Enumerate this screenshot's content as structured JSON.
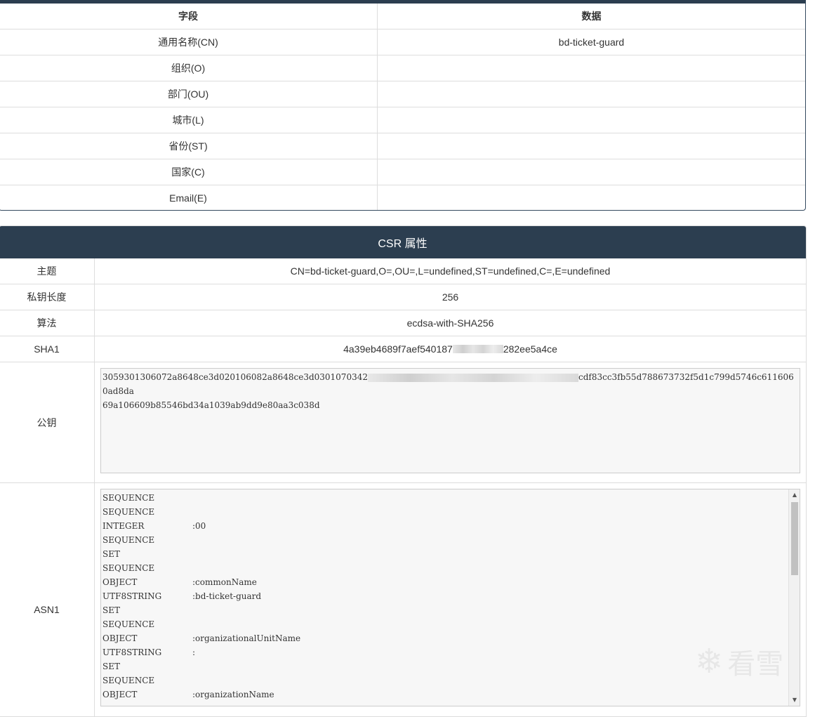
{
  "subject_table": {
    "headers": {
      "field": "字段",
      "data": "数据"
    },
    "rows": [
      {
        "field": "通用名称(CN)",
        "data": "bd-ticket-guard"
      },
      {
        "field": "组织(O)",
        "data": ""
      },
      {
        "field": "部门(OU)",
        "data": ""
      },
      {
        "field": "城市(L)",
        "data": ""
      },
      {
        "field": "省份(ST)",
        "data": ""
      },
      {
        "field": "国家(C)",
        "data": ""
      },
      {
        "field": "Email(E)",
        "data": ""
      }
    ]
  },
  "csr": {
    "title": "CSR 属性",
    "subject_label": "主题",
    "subject_value": "CN=bd-ticket-guard,O=,OU=,L=undefined,ST=undefined,C=,E=undefined",
    "keylen_label": "私钥长度",
    "keylen_value": "256",
    "algo_label": "算法",
    "algo_value": "ecdsa-with-SHA256",
    "sha1_label": "SHA1",
    "sha1_prefix": "4a39eb4689f7aef540187",
    "sha1_suffix": "282ee5a4ce",
    "pubkey_label": "公钥",
    "pubkey_prefix": "3059301306072a8648ce3d020106082a8648ce3d0301070342",
    "pubkey_suffix": "cdf83cc3fb55d788673732f5d1c799d5746c6116060ad8da",
    "pubkey_line2": "69a106609b85546bd34a1039ab9dd9e80aa3c038d",
    "asn1_label": "ASN1",
    "asn1_lines": [
      {
        "type": "SEQUENCE",
        "value": ""
      },
      {
        "type": "SEQUENCE",
        "value": ""
      },
      {
        "type": "INTEGER",
        "value": ":00"
      },
      {
        "type": "SEQUENCE",
        "value": ""
      },
      {
        "type": "SET",
        "value": ""
      },
      {
        "type": "SEQUENCE",
        "value": ""
      },
      {
        "type": "OBJECT",
        "value": ":commonName"
      },
      {
        "type": "UTF8STRING",
        "value": ":bd-ticket-guard"
      },
      {
        "type": "SET",
        "value": ""
      },
      {
        "type": "SEQUENCE",
        "value": ""
      },
      {
        "type": "OBJECT",
        "value": ":organizationalUnitName"
      },
      {
        "type": "UTF8STRING",
        "value": ":"
      },
      {
        "type": "SET",
        "value": ""
      },
      {
        "type": "SEQUENCE",
        "value": ""
      },
      {
        "type": "OBJECT",
        "value": ":organizationName"
      }
    ]
  },
  "watermark": {
    "icon": "snowflake-icon",
    "text": "看雪"
  }
}
